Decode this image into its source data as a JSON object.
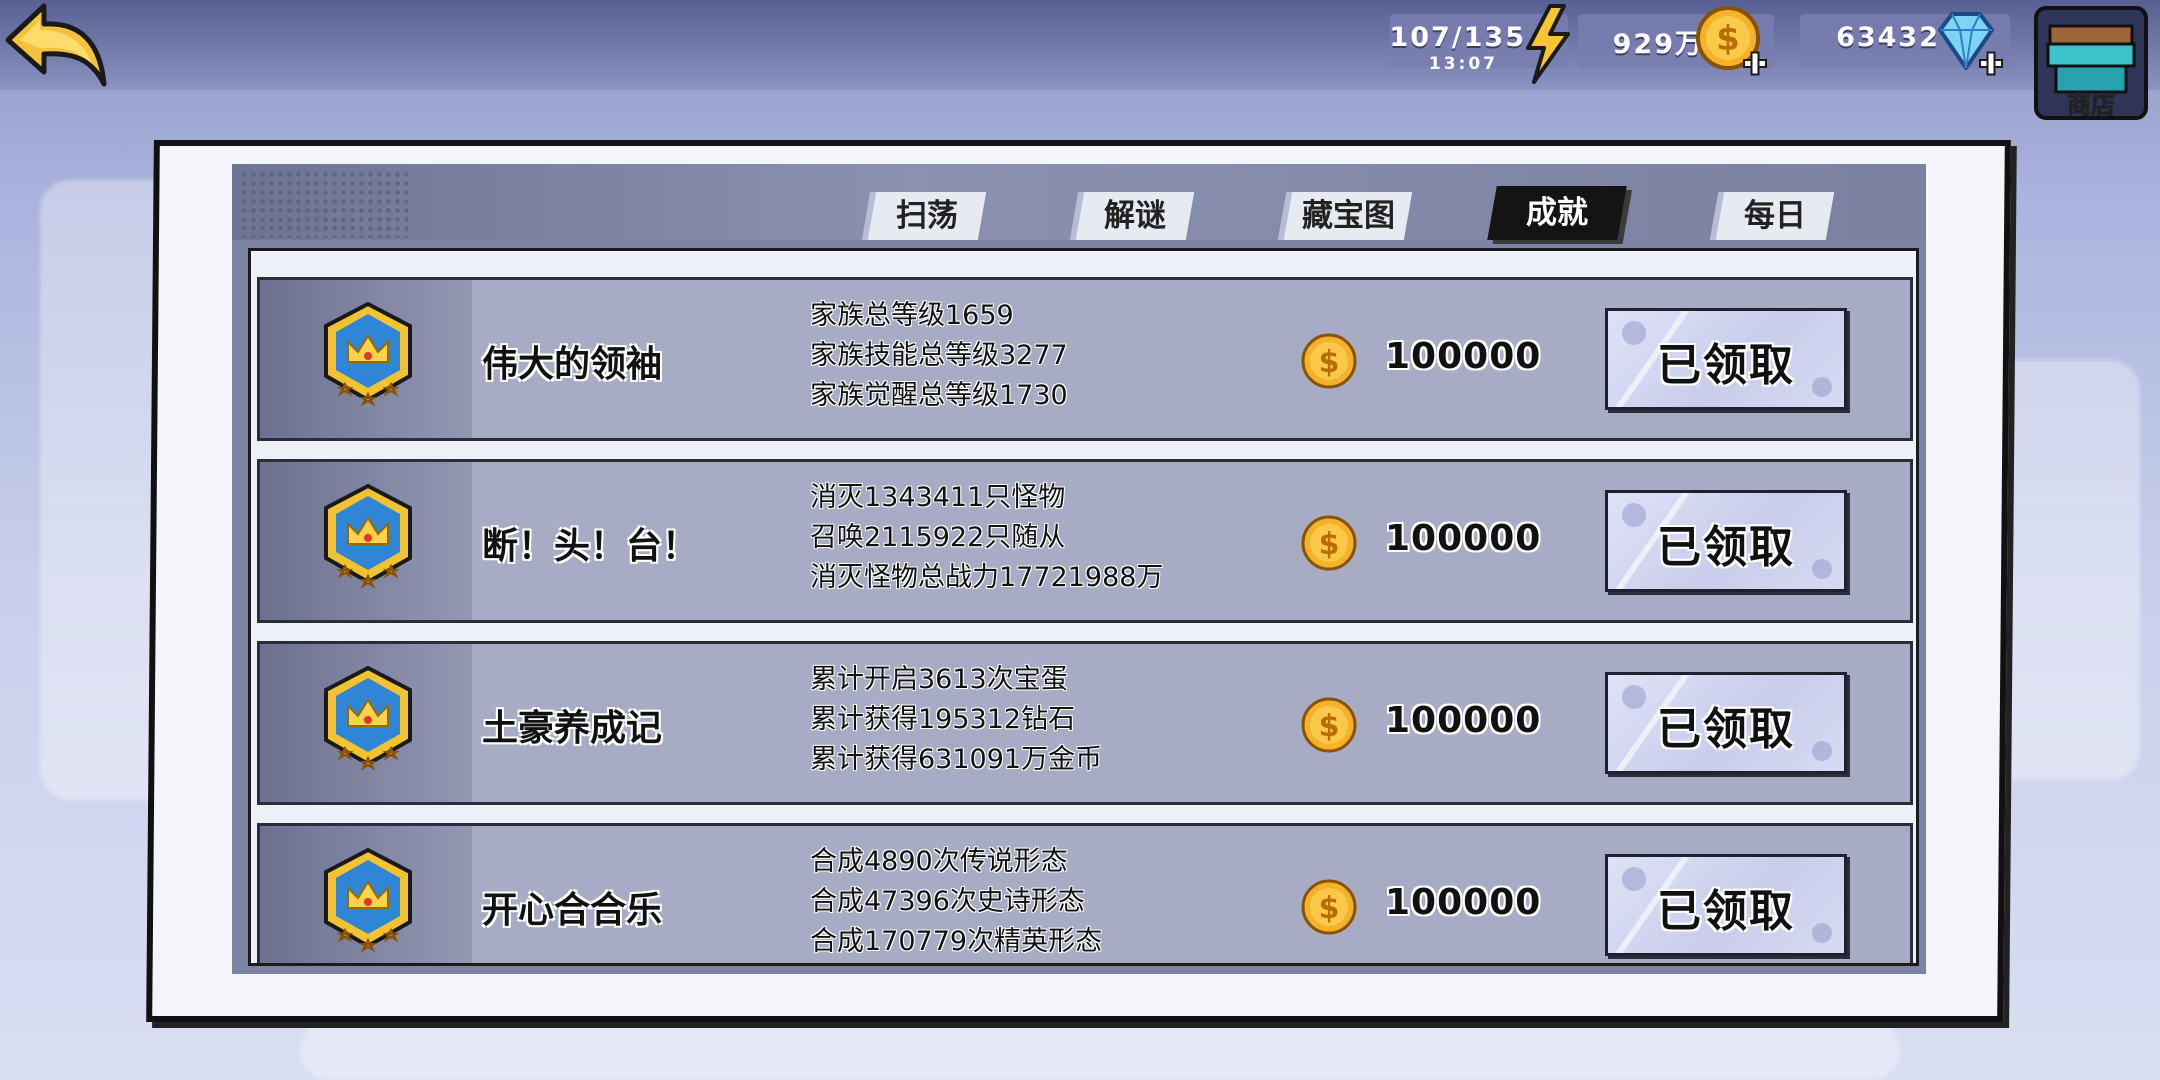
{
  "header": {
    "back_icon": "back-arrow-icon",
    "stamina": {
      "value": "107/135",
      "timer": "13:07",
      "icon": "lightning-icon"
    },
    "gold": {
      "value": "929万",
      "icon": "gold-coin-plus-icon"
    },
    "diamonds": {
      "value": "63432",
      "icon": "diamond-plus-icon"
    },
    "shop": {
      "label": "商店",
      "icon": "shop-icon"
    }
  },
  "tabs": [
    {
      "label": "扫荡"
    },
    {
      "label": "解谜"
    },
    {
      "label": "藏宝图"
    },
    {
      "label": "成就",
      "active": true
    },
    {
      "label": "每日"
    }
  ],
  "achievements": [
    {
      "name": "伟大的领袖",
      "lines": [
        "家族总等级1659",
        "家族技能总等级3277",
        "家族觉醒总等级1730"
      ],
      "reward": "100000",
      "button": "已领取"
    },
    {
      "name": "断！头！台！",
      "lines": [
        "消灭1343411只怪物",
        "召唤2115922只随从",
        "消灭怪物总战力17721988万"
      ],
      "reward": "100000",
      "button": "已领取"
    },
    {
      "name": "土豪养成记",
      "lines": [
        "累计开启3613次宝蛋",
        "累计获得195312钻石",
        "累计获得631091万金币"
      ],
      "reward": "100000",
      "button": "已领取"
    },
    {
      "name": "开心合合乐",
      "lines": [
        "合成4890次传说形态",
        "合成47396次史诗形态",
        "合成170779次精英形态"
      ],
      "reward": "100000",
      "button": "已领取"
    }
  ],
  "colors": {
    "gold": "#f2a81e",
    "badge_blue": "#2f86d6",
    "panel": "#7d83a3",
    "row": "#a7acc4"
  }
}
